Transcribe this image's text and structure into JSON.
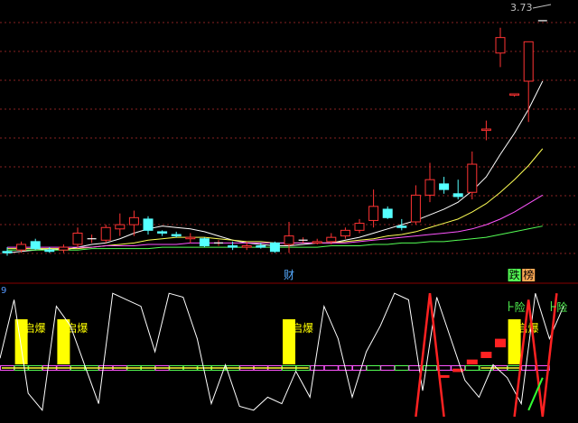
{
  "chart_data": [
    {
      "type": "candlestick",
      "name_en": "price-panel",
      "max_price_label": "3.73",
      "y_range": [
        2.05,
        3.8
      ],
      "colors": {
        "up": "#ff3333",
        "down": "#55ffff",
        "ma1": "#ffffff",
        "ma2": "#ffff55",
        "ma3": "#ff55ff",
        "ma4": "#55ff55"
      },
      "candles": [
        {
          "o": 2.09,
          "h": 2.12,
          "l": 2.06,
          "c": 2.08
        },
        {
          "o": 2.1,
          "h": 2.16,
          "l": 2.08,
          "c": 2.14
        },
        {
          "o": 2.16,
          "h": 2.18,
          "l": 2.1,
          "c": 2.11
        },
        {
          "o": 2.1,
          "h": 2.12,
          "l": 2.08,
          "c": 2.09
        },
        {
          "o": 2.1,
          "h": 2.14,
          "l": 2.08,
          "c": 2.12
        },
        {
          "o": 2.14,
          "h": 2.26,
          "l": 2.12,
          "c": 2.22
        },
        {
          "o": 2.18,
          "h": 2.21,
          "l": 2.15,
          "c": 2.18
        },
        {
          "o": 2.17,
          "h": 2.28,
          "l": 2.15,
          "c": 2.26
        },
        {
          "o": 2.25,
          "h": 2.36,
          "l": 2.2,
          "c": 2.28
        },
        {
          "o": 2.28,
          "h": 2.38,
          "l": 2.2,
          "c": 2.33
        },
        {
          "o": 2.32,
          "h": 2.34,
          "l": 2.21,
          "c": 2.24
        },
        {
          "o": 2.23,
          "h": 2.24,
          "l": 2.2,
          "c": 2.22
        },
        {
          "o": 2.21,
          "h": 2.23,
          "l": 2.19,
          "c": 2.2
        },
        {
          "o": 2.18,
          "h": 2.22,
          "l": 2.15,
          "c": 2.19
        },
        {
          "o": 2.18,
          "h": 2.19,
          "l": 2.12,
          "c": 2.13
        },
        {
          "o": 2.15,
          "h": 2.17,
          "l": 2.13,
          "c": 2.15
        },
        {
          "o": 2.13,
          "h": 2.16,
          "l": 2.1,
          "c": 2.12
        },
        {
          "o": 2.12,
          "h": 2.16,
          "l": 2.1,
          "c": 2.13
        },
        {
          "o": 2.13,
          "h": 2.15,
          "l": 2.11,
          "c": 2.12
        },
        {
          "o": 2.15,
          "h": 2.16,
          "l": 2.08,
          "c": 2.09
        },
        {
          "o": 2.14,
          "h": 2.3,
          "l": 2.08,
          "c": 2.2
        },
        {
          "o": 2.17,
          "h": 2.19,
          "l": 2.15,
          "c": 2.17
        },
        {
          "o": 2.15,
          "h": 2.18,
          "l": 2.14,
          "c": 2.16
        },
        {
          "o": 2.16,
          "h": 2.22,
          "l": 2.14,
          "c": 2.19
        },
        {
          "o": 2.2,
          "h": 2.26,
          "l": 2.18,
          "c": 2.24
        },
        {
          "o": 2.24,
          "h": 2.32,
          "l": 2.22,
          "c": 2.29
        },
        {
          "o": 2.31,
          "h": 2.53,
          "l": 2.26,
          "c": 2.41
        },
        {
          "o": 2.39,
          "h": 2.41,
          "l": 2.32,
          "c": 2.33
        },
        {
          "o": 2.27,
          "h": 2.32,
          "l": 2.24,
          "c": 2.26
        },
        {
          "o": 2.3,
          "h": 2.56,
          "l": 2.28,
          "c": 2.49
        },
        {
          "o": 2.49,
          "h": 2.72,
          "l": 2.44,
          "c": 2.6
        },
        {
          "o": 2.57,
          "h": 2.62,
          "l": 2.5,
          "c": 2.53
        },
        {
          "o": 2.5,
          "h": 2.6,
          "l": 2.46,
          "c": 2.48
        },
        {
          "o": 2.51,
          "h": 2.8,
          "l": 2.46,
          "c": 2.71
        },
        {
          "o": 2.95,
          "h": 3.02,
          "l": 2.88,
          "c": 2.96
        },
        {
          "o": 3.5,
          "h": 3.68,
          "l": 3.4,
          "c": 3.61
        },
        {
          "o": 3.2,
          "h": 3.21,
          "l": 3.19,
          "c": 3.21
        },
        {
          "o": 3.3,
          "h": 3.58,
          "l": 3.01,
          "c": 3.58
        },
        {
          "o": 3.73,
          "h": 3.73,
          "l": 3.73,
          "c": 3.73
        }
      ],
      "ma": [
        {
          "name": "ma1",
          "values": [
            2.08,
            2.09,
            2.1,
            2.11,
            2.1,
            2.12,
            2.14,
            2.15,
            2.18,
            2.22,
            2.25,
            2.27,
            2.26,
            2.25,
            2.23,
            2.2,
            2.17,
            2.15,
            2.14,
            2.13,
            2.13,
            2.14,
            2.15,
            2.15,
            2.17,
            2.19,
            2.22,
            2.25,
            2.28,
            2.31,
            2.35,
            2.39,
            2.44,
            2.52,
            2.62,
            2.78,
            2.93,
            3.1,
            3.3
          ]
        },
        {
          "name": "ma2",
          "values": [
            2.11,
            2.11,
            2.11,
            2.11,
            2.11,
            2.11,
            2.12,
            2.13,
            2.14,
            2.15,
            2.17,
            2.18,
            2.19,
            2.19,
            2.19,
            2.18,
            2.17,
            2.16,
            2.16,
            2.15,
            2.15,
            2.15,
            2.15,
            2.15,
            2.16,
            2.17,
            2.18,
            2.2,
            2.21,
            2.23,
            2.26,
            2.29,
            2.32,
            2.37,
            2.43,
            2.51,
            2.6,
            2.7,
            2.82
          ]
        },
        {
          "name": "ma3",
          "values": [
            2.12,
            2.12,
            2.12,
            2.12,
            2.12,
            2.12,
            2.12,
            2.13,
            2.13,
            2.13,
            2.14,
            2.14,
            2.14,
            2.15,
            2.15,
            2.15,
            2.15,
            2.15,
            2.15,
            2.15,
            2.15,
            2.15,
            2.15,
            2.15,
            2.15,
            2.16,
            2.17,
            2.18,
            2.19,
            2.2,
            2.21,
            2.22,
            2.23,
            2.25,
            2.28,
            2.32,
            2.37,
            2.43,
            2.49
          ]
        },
        {
          "name": "ma4",
          "values": [
            2.1,
            2.1,
            2.1,
            2.1,
            2.1,
            2.1,
            2.11,
            2.11,
            2.11,
            2.11,
            2.11,
            2.12,
            2.12,
            2.12,
            2.12,
            2.12,
            2.12,
            2.12,
            2.12,
            2.12,
            2.12,
            2.12,
            2.12,
            2.13,
            2.13,
            2.13,
            2.14,
            2.14,
            2.15,
            2.15,
            2.16,
            2.16,
            2.17,
            2.18,
            2.19,
            2.21,
            2.23,
            2.25,
            2.27
          ]
        }
      ],
      "annotations": [
        {
          "index": 20,
          "text": "财",
          "color": "#55aaff"
        },
        {
          "index": 36,
          "text": "跌",
          "color": "#000000",
          "bg": "#55ff55"
        },
        {
          "index": 37,
          "text": "榜",
          "color": "#000000",
          "bg": "#ffaa55"
        }
      ]
    },
    {
      "type": "indicator",
      "name_en": "signal-panel",
      "axis_label": "9",
      "y_range": [
        0,
        100
      ],
      "line": [
        45,
        90,
        18,
        5,
        85,
        70,
        40,
        10,
        95,
        90,
        85,
        50,
        95,
        92,
        60,
        10,
        40,
        8,
        5,
        15,
        10,
        35,
        15,
        85,
        60,
        15,
        50,
        70,
        95,
        90,
        20,
        92,
        60,
        28,
        15,
        40,
        30,
        10,
        95,
        60,
        85
      ],
      "line_index_offset": 0,
      "base_bar_colors": [
        "#ff55ff",
        "#55ff55",
        "#55ff55",
        "#ff55ff",
        "#ff55ff",
        "#55ff55",
        "#55ff55",
        "#ff55ff",
        "#ff55ff",
        "#55ff55",
        "#55ff55",
        "#ff55ff",
        "#55ff55",
        "#55ff55",
        "#55ff55",
        "#55ff55",
        "#55ff55",
        "#ff55ff",
        "#ff55ff",
        "#ff55ff",
        "#55ff55",
        "#55ff55",
        "#ff55ff",
        "#ff55ff",
        "#ff55ff",
        "#ff55ff",
        "#55ff55",
        "#ff55ff",
        "#55ff55",
        "#ff55ff",
        "#55ff55",
        "#ff55ff",
        "#ff55ff",
        "#55ff55",
        "#55ff55",
        "#ff55ff",
        "#55ff55",
        "#ff55ff",
        "#ff55ff"
      ],
      "yellow_blocks": [
        1,
        4,
        20,
        36
      ],
      "yellow_line_segments": [
        [
          0,
          21
        ],
        [
          34,
          36
        ]
      ],
      "qibao_indices": [
        1,
        4,
        20,
        36
      ],
      "qibao_text": "启爆",
      "red_line": [
        [
          29,
          0
        ],
        [
          30,
          95
        ],
        [
          31,
          0
        ]
      ],
      "red_line2": [
        [
          36,
          0
        ],
        [
          37,
          90
        ],
        [
          38,
          0
        ],
        [
          39,
          95
        ]
      ],
      "red_steps": [
        {
          "i": 31,
          "v": 10
        },
        {
          "i": 32,
          "v": 15
        },
        {
          "i": 33,
          "v": 22
        },
        {
          "i": 34,
          "v": 28
        },
        {
          "i": 35,
          "v": 38
        }
      ],
      "green_line": [
        [
          37,
          5
        ],
        [
          38,
          30
        ]
      ],
      "xian_text": "险",
      "xian_indices": [
        36,
        39
      ]
    }
  ]
}
